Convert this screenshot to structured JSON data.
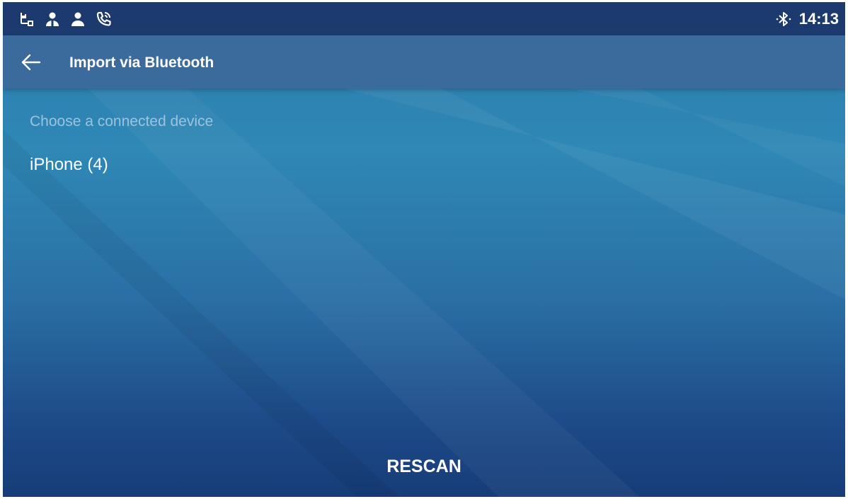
{
  "status_bar": {
    "icons": [
      "ethernet-icon",
      "contact-icon",
      "person-icon",
      "phone-call-icon"
    ],
    "bluetooth_icon": "bluetooth-icon",
    "time": "14:13"
  },
  "toolbar": {
    "back_icon": "arrow-left-icon",
    "title": "Import via Bluetooth"
  },
  "content": {
    "section_label": "Choose a connected device",
    "devices": [
      {
        "name": "iPhone (4)"
      }
    ]
  },
  "actions": {
    "rescan_label": "RESCAN"
  },
  "colors": {
    "status_bar": "#1d3a6e",
    "toolbar": "#3b6a9d",
    "background_top": "#2f88b6",
    "background_bottom": "#173d78",
    "section_label": "#9cc3dc",
    "text": "#ffffff"
  }
}
